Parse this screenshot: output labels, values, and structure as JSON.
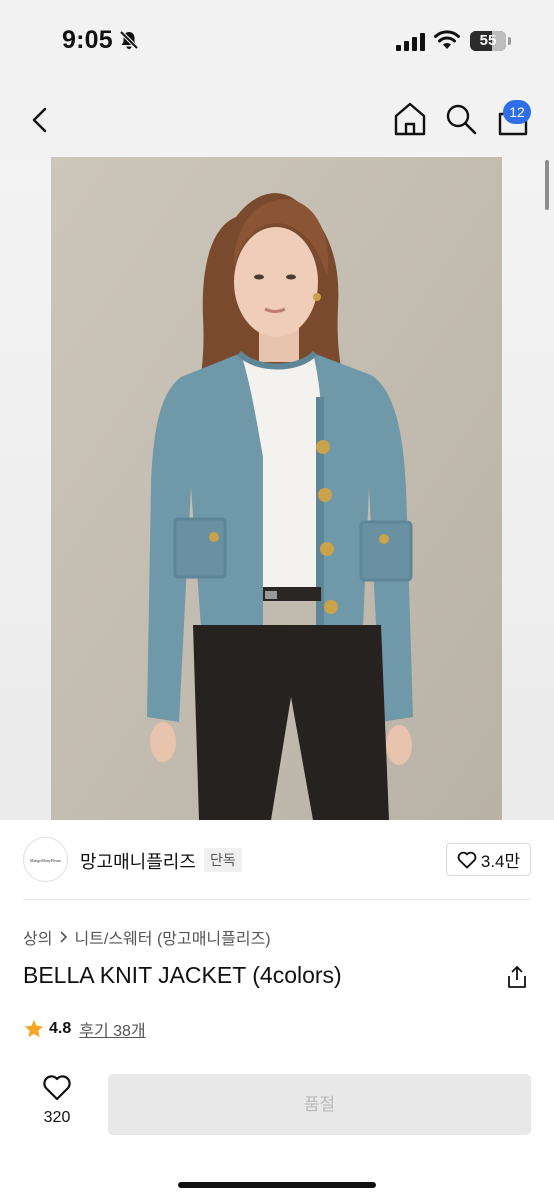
{
  "status_bar": {
    "time": "9:05",
    "battery": "55"
  },
  "nav": {
    "cart_badge": "12"
  },
  "brand": {
    "logo_text": "MangoManyPlease",
    "name": "망고매니플리즈",
    "exclusive_label": "단독",
    "likes": "3.4만"
  },
  "breadcrumb": {
    "category": "상의",
    "subcategory": "니트/스웨터 (망고매니플리즈)"
  },
  "product": {
    "title": "BELLA KNIT JACKET (4colors)",
    "rating": "4.8",
    "reviews_label": "후기 38개"
  },
  "bottom_bar": {
    "wish_count": "320",
    "buy_label": "품절"
  },
  "colors": {
    "badge": "#2f6ee6",
    "star": "#f5a623",
    "cardigan": "#6f98a8",
    "photo_background": "#c5beb2"
  }
}
